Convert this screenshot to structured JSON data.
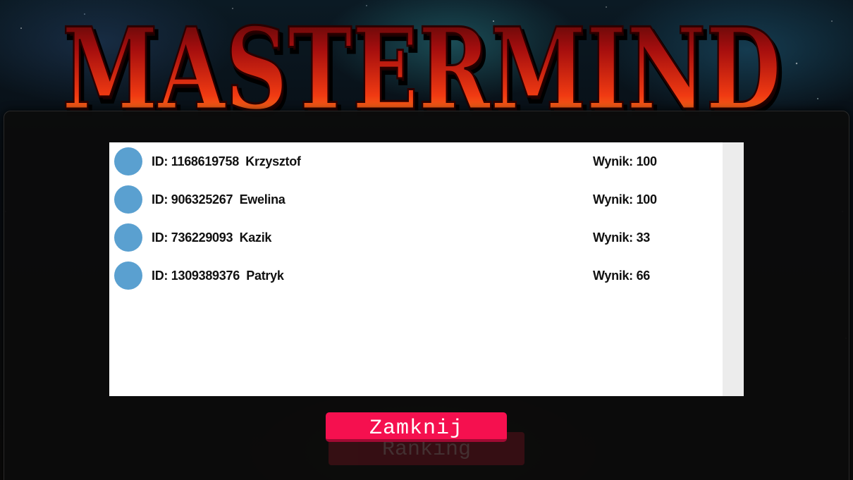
{
  "game_title": "MASTERMIND",
  "ranking": {
    "entries": [
      {
        "id_label": "ID: 1168619758  Krzysztof",
        "score_label": "Wynik: 100"
      },
      {
        "id_label": "ID: 906325267  Ewelina",
        "score_label": "Wynik: 100"
      },
      {
        "id_label": "ID: 736229093  Kazik",
        "score_label": "Wynik: 33"
      },
      {
        "id_label": "ID: 1309389376  Patryk",
        "score_label": "Wynik: 66"
      }
    ]
  },
  "buttons": {
    "close_label": "Zamknij",
    "ranking_label": "Ranking"
  },
  "colors": {
    "accent": "#f5104f",
    "avatar": "#5aa0d0",
    "title_fire": "#e2231a"
  },
  "icons": {
    "avatar": "user-avatar-icon"
  }
}
